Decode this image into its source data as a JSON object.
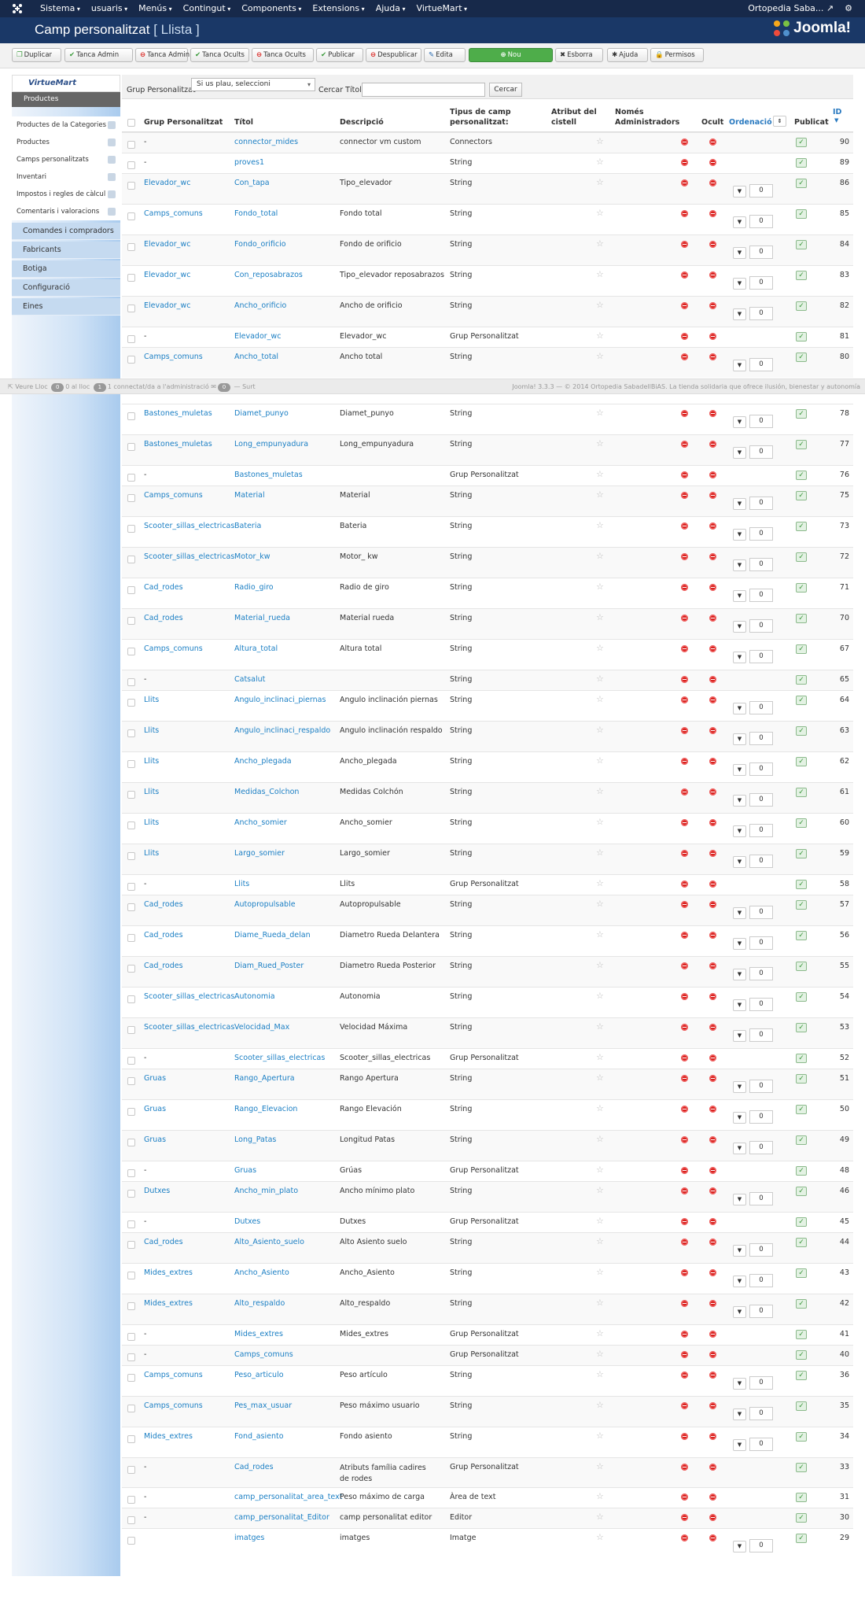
{
  "topnav": {
    "menus": [
      "Sistema",
      "usuaris",
      "Menús",
      "Contingut",
      "Components",
      "Extensions",
      "Ajuda",
      "VirtueMart"
    ],
    "site": "Ortopedia Saba...",
    "gear": "⚙"
  },
  "titlebar": {
    "title": "Camp personalitzat",
    "subtitle": "[ Llista ]",
    "brand": "Joomla!"
  },
  "toolbar": {
    "buttons": [
      {
        "label": "Duplicar",
        "icon": "copy-icon",
        "glyph": "❐",
        "tone": "g"
      },
      {
        "label": "Tanca Admin",
        "icon": "check-icon",
        "glyph": "✔",
        "tone": "g"
      },
      {
        "label": "Tanca Admin",
        "icon": "minus-circle-icon",
        "glyph": "⊖",
        "tone": "r"
      },
      {
        "label": "Tanca Ocults",
        "icon": "check-icon",
        "glyph": "✔",
        "tone": "g"
      },
      {
        "label": "Tanca Ocults",
        "icon": "minus-circle-icon",
        "glyph": "⊖",
        "tone": "r"
      },
      {
        "label": "Publicar",
        "icon": "check-icon",
        "glyph": "✔",
        "tone": "g"
      },
      {
        "label": "Despublicar",
        "icon": "minus-circle-icon",
        "glyph": "⊖",
        "tone": "r"
      },
      {
        "label": "Edita",
        "icon": "edit-icon",
        "glyph": "✎",
        "tone": "b"
      },
      {
        "label": "Nou",
        "icon": "plus-circle-icon",
        "glyph": "⊕",
        "tone": "w"
      },
      {
        "label": "Esborra",
        "icon": "delete-icon",
        "glyph": "✖",
        "tone": "k"
      },
      {
        "label": "Ajuda",
        "icon": "help-icon",
        "glyph": "✱",
        "tone": "k"
      },
      {
        "label": "Permisos",
        "icon": "lock-icon",
        "glyph": "🔒",
        "tone": "k"
      }
    ]
  },
  "sidebar": {
    "logo": "VirtueMart",
    "heading": "Productes",
    "items": [
      "Productes de la Categories",
      "Productes",
      "Camps personalitzats",
      "Inventari",
      "Impostos i regles de càlcul",
      "Comentaris i valoracions"
    ],
    "sections": [
      "Comandes i compradors",
      "Fabricants",
      "Botiga",
      "Configuració",
      "Eines"
    ]
  },
  "filter": {
    "label_group": "Grup Personalitzat",
    "select_value": "Si us plau, seleccioni",
    "label_search": "Cercar Títol",
    "search_value": "",
    "search_button": "Cercar"
  },
  "table": {
    "headers": {
      "group": "Grup Personalitzat",
      "title": "Títol",
      "description": "Descripció",
      "type": "Tipus de camp personalitzat:",
      "cart": "Atribut del cistell",
      "admin": "Només Administradors",
      "hidden": "Ocult",
      "ordering": "Ordenació",
      "published": "Publicat",
      "id": "ID"
    },
    "rows": [
      {
        "g": "-",
        "t": "connector_mides",
        "d": "connector vm custom",
        "ty": "Connectors",
        "o": null,
        "id": "90"
      },
      {
        "g": "-",
        "t": "proves1",
        "d": "",
        "ty": "String",
        "o": null,
        "id": "89"
      },
      {
        "g": "Elevador_wc",
        "t": "Con_tapa",
        "d": "Tipo_elevador",
        "ty": "String",
        "o": "0",
        "id": "86"
      },
      {
        "g": "Camps_comuns",
        "t": "Fondo_total",
        "d": "Fondo total",
        "ty": "String",
        "o": "0",
        "id": "85"
      },
      {
        "g": "Elevador_wc",
        "t": "Fondo_orificio",
        "d": "Fondo de orificio",
        "ty": "String",
        "o": "0",
        "id": "84"
      },
      {
        "g": "Elevador_wc",
        "t": "Con_reposabrazos",
        "d": "Tipo_elevador reposabrazos",
        "ty": "String",
        "o": "0",
        "id": "83"
      },
      {
        "g": "Elevador_wc",
        "t": "Ancho_orificio",
        "d": "Ancho de orificio",
        "ty": "String",
        "o": "0",
        "id": "82"
      },
      {
        "g": "-",
        "t": "Elevador_wc",
        "d": "Elevador_wc",
        "ty": "Grup Personalitzat",
        "o": null,
        "id": "81"
      },
      {
        "g": "Camps_comuns",
        "t": "Ancho_total",
        "d": "Ancho total",
        "ty": "String",
        "o": "0",
        "id": "80"
      },
      {
        "g": "Bastones_muletas",
        "t": "Diamet_punyo",
        "d": "Diamet_punyo",
        "ty": "String",
        "o": "0",
        "id": "78"
      },
      {
        "g": "Bastones_muletas",
        "t": "Long_empunyadura",
        "d": "Long_empunyadura",
        "ty": "String",
        "o": "0",
        "id": "77"
      },
      {
        "g": "-",
        "t": "Bastones_muletas",
        "d": "",
        "ty": "Grup Personalitzat",
        "o": null,
        "id": "76"
      },
      {
        "g": "Camps_comuns",
        "t": "Material",
        "d": "Material",
        "ty": "String",
        "o": "0",
        "id": "75"
      },
      {
        "g": "Scooter_sillas_electricas",
        "t": "Bateria",
        "d": "Bateria",
        "ty": "String",
        "o": "0",
        "id": "73"
      },
      {
        "g": "Scooter_sillas_electricas",
        "t": "Motor_kw",
        "d": "Motor_ kw",
        "ty": "String",
        "o": "0",
        "id": "72"
      },
      {
        "g": "Cad_rodes",
        "t": "Radio_giro",
        "d": "Radio de giro",
        "ty": "String",
        "o": "0",
        "id": "71"
      },
      {
        "g": "Cad_rodes",
        "t": "Material_rueda",
        "d": "Material rueda",
        "ty": "String",
        "o": "0",
        "id": "70"
      },
      {
        "g": "Camps_comuns",
        "t": "Altura_total",
        "d": "Altura total",
        "ty": "String",
        "o": "0",
        "id": "67"
      },
      {
        "g": "-",
        "t": "Catsalut",
        "d": "",
        "ty": "String",
        "o": null,
        "id": "65"
      },
      {
        "g": "Llits",
        "t": "Angulo_inclinaci_piernas",
        "d": "Angulo inclinación piernas",
        "ty": "String",
        "o": "0",
        "id": "64"
      },
      {
        "g": "Llits",
        "t": "Angulo_inclinaci_respaldo",
        "d": "Angulo inclinación respaldo",
        "ty": "String",
        "o": "0",
        "id": "63"
      },
      {
        "g": "Llits",
        "t": "Ancho_plegada",
        "d": "Ancho_plegada",
        "ty": "String",
        "o": "0",
        "id": "62"
      },
      {
        "g": "Llits",
        "t": "Medidas_Colchon",
        "d": "Medidas Colchón",
        "ty": "String",
        "o": "0",
        "id": "61"
      },
      {
        "g": "Llits",
        "t": "Ancho_somier",
        "d": "Ancho_somier",
        "ty": "String",
        "o": "0",
        "id": "60"
      },
      {
        "g": "Llits",
        "t": "Largo_somier",
        "d": "Largo_somier",
        "ty": "String",
        "o": "0",
        "id": "59"
      },
      {
        "g": "-",
        "t": "Llits",
        "d": "Llits",
        "ty": "Grup Personalitzat",
        "o": null,
        "id": "58"
      },
      {
        "g": "Cad_rodes",
        "t": "Autopropulsable",
        "d": "Autopropulsable",
        "ty": "String",
        "o": "0",
        "id": "57"
      },
      {
        "g": "Cad_rodes",
        "t": "Diame_Rueda_delan",
        "d": "Diametro Rueda Delantera",
        "ty": "String",
        "o": "0",
        "id": "56"
      },
      {
        "g": "Cad_rodes",
        "t": "Diam_Rued_Poster",
        "d": "Diametro Rueda Posterior",
        "ty": "String",
        "o": "0",
        "id": "55"
      },
      {
        "g": "Scooter_sillas_electricas",
        "t": "Autonomia",
        "d": "Autonomia",
        "ty": "String",
        "o": "0",
        "id": "54"
      },
      {
        "g": "Scooter_sillas_electricas",
        "t": "Velocidad_Max",
        "d": "Velocidad Máxima",
        "ty": "String",
        "o": "0",
        "id": "53"
      },
      {
        "g": "-",
        "t": "Scooter_sillas_electricas",
        "d": "Scooter_sillas_electricas",
        "ty": "Grup Personalitzat",
        "o": null,
        "id": "52"
      },
      {
        "g": "Gruas",
        "t": "Rango_Apertura",
        "d": "Rango Apertura",
        "ty": "String",
        "o": "0",
        "id": "51"
      },
      {
        "g": "Gruas",
        "t": "Rango_Elevacion",
        "d": "Rango Elevación",
        "ty": "String",
        "o": "0",
        "id": "50"
      },
      {
        "g": "Gruas",
        "t": "Long_Patas",
        "d": "Longitud Patas",
        "ty": "String",
        "o": "0",
        "id": "49"
      },
      {
        "g": "-",
        "t": "Gruas",
        "d": "Grúas",
        "ty": "Grup Personalitzat",
        "o": null,
        "id": "48"
      },
      {
        "g": "Dutxes",
        "t": "Ancho_min_plato",
        "d": "Ancho mínimo plato",
        "ty": "String",
        "o": "0",
        "id": "46"
      },
      {
        "g": "-",
        "t": "Dutxes",
        "d": "Dutxes",
        "ty": "Grup Personalitzat",
        "o": null,
        "id": "45"
      },
      {
        "g": "Cad_rodes",
        "t": "Alto_Asiento_suelo",
        "d": "Alto Asiento suelo",
        "ty": "String",
        "o": "0",
        "id": "44"
      },
      {
        "g": "Mides_extres",
        "t": "Ancho_Asiento",
        "d": "Ancho_Asiento",
        "ty": "String",
        "o": "0",
        "id": "43"
      },
      {
        "g": "Mides_extres",
        "t": "Alto_respaldo",
        "d": "Alto_respaldo",
        "ty": "String",
        "o": "0",
        "id": "42"
      },
      {
        "g": "-",
        "t": "Mides_extres",
        "d": "Mides_extres",
        "ty": "Grup Personalitzat",
        "o": null,
        "id": "41"
      },
      {
        "g": "-",
        "t": "Camps_comuns",
        "d": "",
        "ty": "Grup Personalitzat",
        "o": null,
        "id": "40"
      },
      {
        "g": "Camps_comuns",
        "t": "Peso_articulo",
        "d": "Peso artículo",
        "ty": "String",
        "o": "0",
        "id": "36"
      },
      {
        "g": "Camps_comuns",
        "t": "Pes_max_usuar",
        "d": "Peso máximo usuario",
        "ty": "String",
        "o": "0",
        "id": "35"
      },
      {
        "g": "Mides_extres",
        "t": "Fond_asiento",
        "d": "Fondo asiento",
        "ty": "String",
        "o": "0",
        "id": "34"
      },
      {
        "g": "-",
        "t": "Cad_rodes",
        "d": "Atributs família cadires de rodes",
        "ty": "Grup Personalitzat",
        "o": null,
        "id": "33"
      },
      {
        "g": "-",
        "t": "camp_personalitat_area_text",
        "d": "Peso máximo de carga",
        "ty": "Àrea de text",
        "o": null,
        "id": "31"
      },
      {
        "g": "-",
        "t": "camp_personalitat_Editor",
        "d": "camp personalitat editor",
        "ty": "Editor",
        "o": null,
        "id": "30"
      },
      {
        "g": "",
        "t": "imatges",
        "d": "imatges",
        "ty": "Imatge",
        "o": "0",
        "id": "29"
      }
    ]
  },
  "statusbar": {
    "view_site": "Veure Lloc",
    "count_front": "0",
    "front_label": "0 al lloc",
    "count_admin": "1",
    "admin_label": "1 connectat/da a l'administració",
    "count_msg": "0",
    "logout": "Surt",
    "footer": "Joomla! 3.3.3 — © 2014 Ortopedia SabadellBiAS. La tienda solidaria que ofrece ilusión, bienestar y autonomía"
  }
}
